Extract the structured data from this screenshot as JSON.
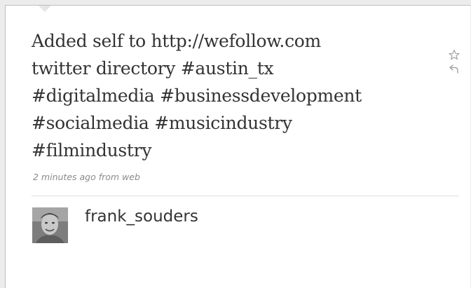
{
  "tweet": {
    "lines": [
      [
        {
          "type": "text",
          "text": "Added self to "
        },
        {
          "type": "link",
          "text": "http://wefollow.com"
        }
      ],
      [
        {
          "type": "text",
          "text": "twitter directory "
        },
        {
          "type": "hashtag",
          "text": "#austin_tx"
        }
      ],
      [
        {
          "type": "hashtag",
          "text": "#digitalmedia"
        },
        {
          "type": "text",
          "text": " "
        },
        {
          "type": "hashtag",
          "text": "#businessdevelopment"
        }
      ],
      [
        {
          "type": "hashtag",
          "text": "#socialmedia"
        },
        {
          "type": "text",
          "text": " "
        },
        {
          "type": "hashtag",
          "text": "#musicindustry"
        }
      ],
      [
        {
          "type": "hashtag",
          "text": "#filmindustry"
        }
      ]
    ],
    "meta": "2 minutes ago from web"
  },
  "actions": {
    "favorite_icon": "star-icon",
    "reply_icon": "reply-icon"
  },
  "author": {
    "username": "frank_souders",
    "avatar_icon": "avatar"
  },
  "colors": {
    "text": "#333333",
    "meta": "#8a8a8a",
    "background": "#ffffff",
    "divider": "#dedede"
  }
}
